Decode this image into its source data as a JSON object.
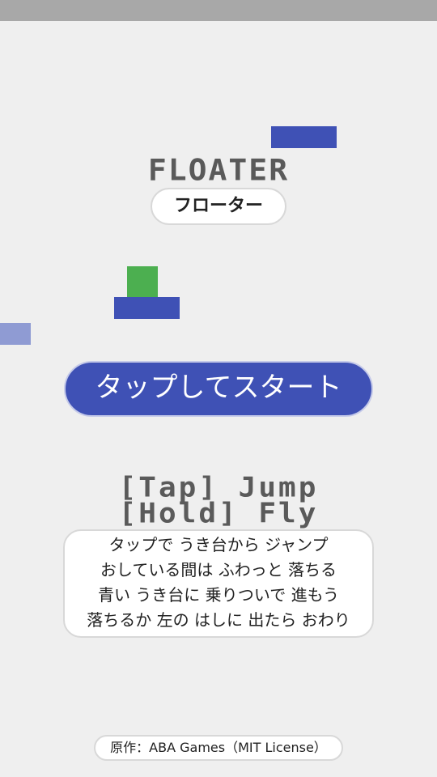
{
  "title": {
    "english": "FLOATER",
    "japanese": "フローター"
  },
  "start_button": {
    "label": "タップしてスタート"
  },
  "controls": {
    "tap": "[Tap] Jump",
    "hold": "[Hold] Fly"
  },
  "instructions": [
    "タップで うき台から ジャンプ",
    "おしている間は ふわっと 落ちる",
    "青い うき台に 乗りついで 進もう",
    "落ちるか 左の はしに 出たら おわり"
  ],
  "credit": "原作：ABA Games（MIT License）",
  "colors": {
    "background": "#efefef",
    "top_bar": "#a8a8a8",
    "platform": "#3f51b5",
    "platform_faint": "#8f9bd3",
    "player": "#4caf50",
    "title_text": "#5a5a5a"
  }
}
